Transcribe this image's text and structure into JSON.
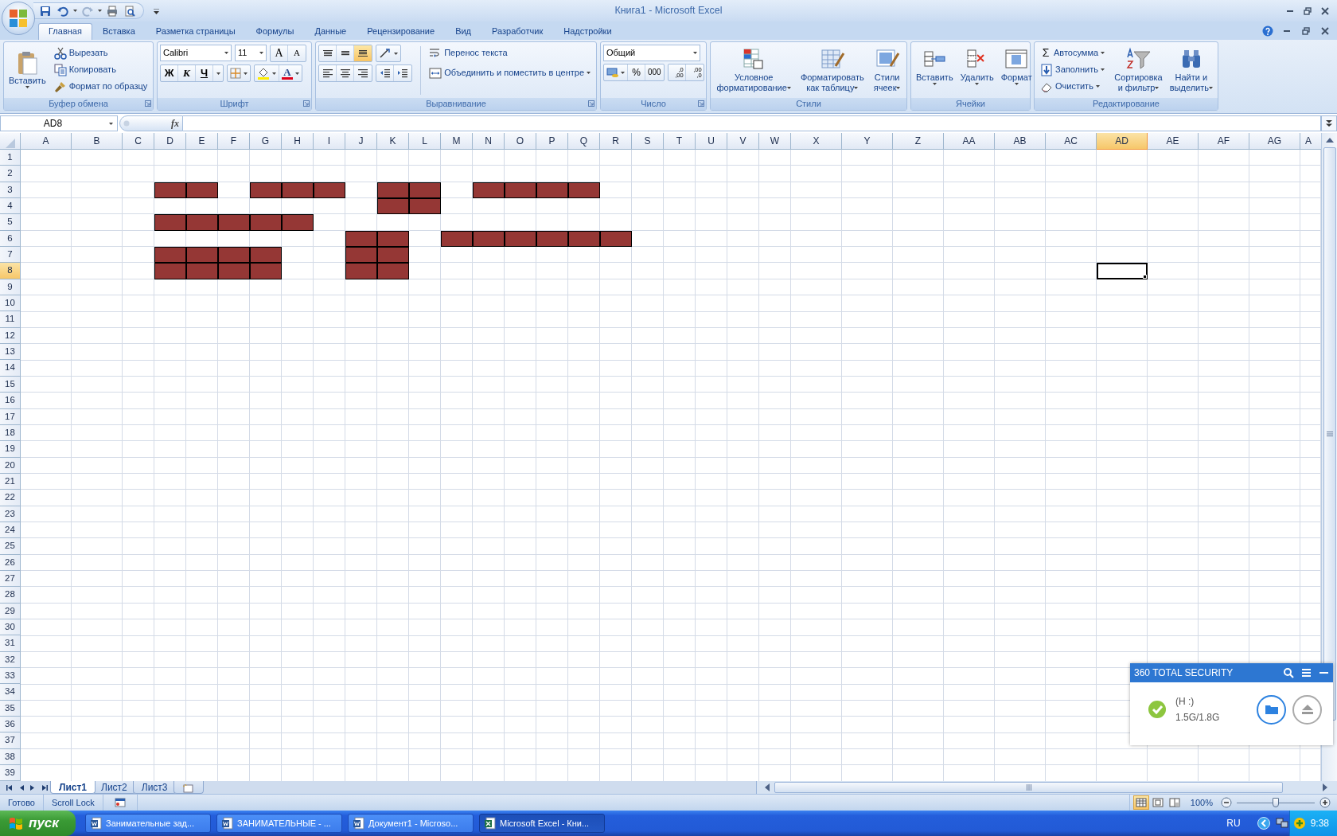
{
  "window": {
    "title": "Книга1 - Microsoft Excel"
  },
  "ribbon_tabs": [
    {
      "label": "Главная",
      "selected": true
    },
    {
      "label": "Вставка",
      "selected": false
    },
    {
      "label": "Разметка страницы",
      "selected": false
    },
    {
      "label": "Формулы",
      "selected": false
    },
    {
      "label": "Данные",
      "selected": false
    },
    {
      "label": "Рецензирование",
      "selected": false
    },
    {
      "label": "Вид",
      "selected": false
    },
    {
      "label": "Разработчик",
      "selected": false
    },
    {
      "label": "Надстройки",
      "selected": false
    }
  ],
  "clipboard": {
    "label": "Буфер обмена",
    "paste": "Вставить",
    "cut": "Вырезать",
    "copy": "Копировать",
    "format_painter": "Формат по образцу"
  },
  "font": {
    "label": "Шрифт",
    "font_name": "Calibri",
    "font_size": "11",
    "grow": "A",
    "shrink": "A",
    "bold": "Ж",
    "italic": "К",
    "underline": "Ч",
    "font_color": "A"
  },
  "alignment": {
    "label": "Выравнивание",
    "vertical_align": [
      {
        "selected": false
      },
      {
        "selected": false
      },
      {
        "selected": true
      }
    ],
    "wrap_text": "Перенос текста",
    "merge": "Объединить и поместить в центре"
  },
  "number": {
    "label": "Число",
    "format": "Общий",
    "percent": "%",
    "thousands": "000",
    "increase_decimal": [
      ",0",
      ",00"
    ],
    "decrease_decimal": [
      ",00",
      ",0"
    ]
  },
  "styles": {
    "label": "Стили",
    "buttons": [
      {
        "lines": [
          "Условное",
          "форматирование"
        ]
      },
      {
        "lines": [
          "Форматировать",
          "как таблицу"
        ]
      },
      {
        "lines": [
          "Стили",
          "ячеек"
        ]
      }
    ]
  },
  "cells": {
    "label": "Ячейки",
    "buttons": [
      "Вставить",
      "Удалить",
      "Формат"
    ]
  },
  "editing": {
    "label": "Редактирование",
    "autosum_symbol": "Σ",
    "autosum": "Автосумма",
    "fill": "Заполнить",
    "clear": "Очистить",
    "sort": [
      "Сортировка",
      "и фильтр"
    ],
    "find": [
      "Найти и",
      "выделить"
    ]
  },
  "formula_bar": {
    "name_box": "AD8",
    "function_label": "fx"
  },
  "sheet": {
    "columns": [
      {
        "label": "A",
        "selected": false
      },
      {
        "label": "B",
        "selected": false
      },
      {
        "label": "C",
        "selected": false
      },
      {
        "label": "D",
        "selected": false
      },
      {
        "label": "E",
        "selected": false
      },
      {
        "label": "F",
        "selected": false
      },
      {
        "label": "G",
        "selected": false
      },
      {
        "label": "H",
        "selected": false
      },
      {
        "label": "I",
        "selected": false
      },
      {
        "label": "J",
        "selected": false
      },
      {
        "label": "K",
        "selected": false
      },
      {
        "label": "L",
        "selected": false
      },
      {
        "label": "M",
        "selected": false
      },
      {
        "label": "N",
        "selected": false
      },
      {
        "label": "O",
        "selected": false
      },
      {
        "label": "P",
        "selected": false
      },
      {
        "label": "Q",
        "selected": false
      },
      {
        "label": "R",
        "selected": false
      },
      {
        "label": "S",
        "selected": false
      },
      {
        "label": "T",
        "selected": false
      },
      {
        "label": "U",
        "selected": false
      },
      {
        "label": "V",
        "selected": false
      },
      {
        "label": "W",
        "selected": false
      },
      {
        "label": "X",
        "selected": false
      },
      {
        "label": "Y",
        "selected": false
      },
      {
        "label": "Z",
        "selected": false
      },
      {
        "label": "AA",
        "selected": false
      },
      {
        "label": "AB",
        "selected": false
      },
      {
        "label": "AC",
        "selected": false
      },
      {
        "label": "AD",
        "selected": true
      },
      {
        "label": "AE",
        "selected": false
      },
      {
        "label": "AF",
        "selected": false
      },
      {
        "label": "AG",
        "selected": false
      },
      {
        "label": "A",
        "selected": false
      }
    ],
    "rows": [
      {
        "label": "1",
        "selected": false
      },
      {
        "label": "2",
        "selected": false
      },
      {
        "label": "3",
        "selected": false,
        "filled": [
          false,
          false,
          false,
          true,
          true,
          false,
          true,
          true,
          true,
          false,
          true,
          true,
          false,
          true,
          true,
          true,
          true,
          false,
          false,
          false,
          false,
          false,
          false,
          false,
          false,
          false,
          false,
          false,
          false,
          false,
          false,
          false,
          false,
          false
        ]
      },
      {
        "label": "4",
        "selected": false,
        "filled": [
          false,
          false,
          false,
          false,
          false,
          false,
          false,
          false,
          false,
          false,
          true,
          true,
          false,
          false,
          false,
          false,
          false,
          false,
          false,
          false,
          false,
          false,
          false,
          false,
          false,
          false,
          false,
          false,
          false,
          false,
          false,
          false,
          false,
          false
        ]
      },
      {
        "label": "5",
        "selected": false,
        "filled": [
          false,
          false,
          false,
          true,
          true,
          true,
          true,
          true,
          false,
          false,
          false,
          false,
          false,
          false,
          false,
          false,
          false,
          false,
          false,
          false,
          false,
          false,
          false,
          false,
          false,
          false,
          false,
          false,
          false,
          false,
          false,
          false,
          false,
          false
        ]
      },
      {
        "label": "6",
        "selected": false,
        "filled": [
          false,
          false,
          false,
          false,
          false,
          false,
          false,
          false,
          false,
          true,
          true,
          false,
          true,
          true,
          true,
          true,
          true,
          true,
          false,
          false,
          false,
          false,
          false,
          false,
          false,
          false,
          false,
          false,
          false,
          false,
          false,
          false,
          false,
          false
        ]
      },
      {
        "label": "7",
        "selected": false,
        "filled": [
          false,
          false,
          false,
          true,
          true,
          true,
          true,
          false,
          false,
          true,
          true,
          false,
          false,
          false,
          false,
          false,
          false,
          false,
          false,
          false,
          false,
          false,
          false,
          false,
          false,
          false,
          false,
          false,
          false,
          false,
          false,
          false,
          false,
          false
        ]
      },
      {
        "label": "8",
        "selected": true,
        "filled": [
          false,
          false,
          false,
          true,
          true,
          true,
          true,
          false,
          false,
          true,
          true,
          false,
          false,
          false,
          false,
          false,
          false,
          false,
          false,
          false,
          false,
          false,
          false,
          false,
          false,
          false,
          false,
          false,
          false,
          false,
          false,
          false,
          false,
          false
        ]
      },
      {
        "label": "9",
        "selected": false
      },
      {
        "label": "10",
        "selected": false
      },
      {
        "label": "11",
        "selected": false
      },
      {
        "label": "12",
        "selected": false
      },
      {
        "label": "13",
        "selected": false
      },
      {
        "label": "14",
        "selected": false
      },
      {
        "label": "15",
        "selected": false
      },
      {
        "label": "16",
        "selected": false
      },
      {
        "label": "17",
        "selected": false
      },
      {
        "label": "18",
        "selected": false
      },
      {
        "label": "19",
        "selected": false
      },
      {
        "label": "20",
        "selected": false
      },
      {
        "label": "21",
        "selected": false
      },
      {
        "label": "22",
        "selected": false
      },
      {
        "label": "23",
        "selected": false
      },
      {
        "label": "24",
        "selected": false
      },
      {
        "label": "25",
        "selected": false
      },
      {
        "label": "26",
        "selected": false
      },
      {
        "label": "27",
        "selected": false
      },
      {
        "label": "28",
        "selected": false
      },
      {
        "label": "29",
        "selected": false
      },
      {
        "label": "30",
        "selected": false
      },
      {
        "label": "31",
        "selected": false
      },
      {
        "label": "32",
        "selected": false
      },
      {
        "label": "33",
        "selected": false
      },
      {
        "label": "34",
        "selected": false
      },
      {
        "label": "35",
        "selected": false
      },
      {
        "label": "36",
        "selected": false
      },
      {
        "label": "37",
        "selected": false
      },
      {
        "label": "38",
        "selected": false
      },
      {
        "label": "39",
        "selected": false
      }
    ]
  },
  "sheet_tabs": [
    {
      "label": "Лист1",
      "selected": true
    },
    {
      "label": "Лист2",
      "selected": false
    },
    {
      "label": "Лист3",
      "selected": false
    }
  ],
  "status_bar": {
    "items": [
      "Готово",
      "Scroll Lock"
    ],
    "views": [
      {
        "selected": true
      },
      {
        "selected": false
      },
      {
        "selected": false
      }
    ],
    "zoom": "100%",
    "zoom_slider": {
      "level": 0.5
    }
  },
  "security_popup": {
    "title": "360 TOTAL SECURITY",
    "drive": "(H :)",
    "usage": "1.5G/1.8G"
  },
  "taskbar": {
    "start": "пуск",
    "tasks": [
      {
        "label": "Занимательные зад...",
        "kind": "word",
        "selected": false
      },
      {
        "label": "ЗАНИМАТЕЛЬНЫЕ - ...",
        "kind": "word",
        "selected": false
      },
      {
        "label": "Документ1 - Microso...",
        "kind": "word",
        "selected": false
      },
      {
        "label": "Microsoft Excel - Кни...",
        "kind": "excel",
        "selected": true
      }
    ],
    "language": "RU",
    "clock": "9:38"
  }
}
